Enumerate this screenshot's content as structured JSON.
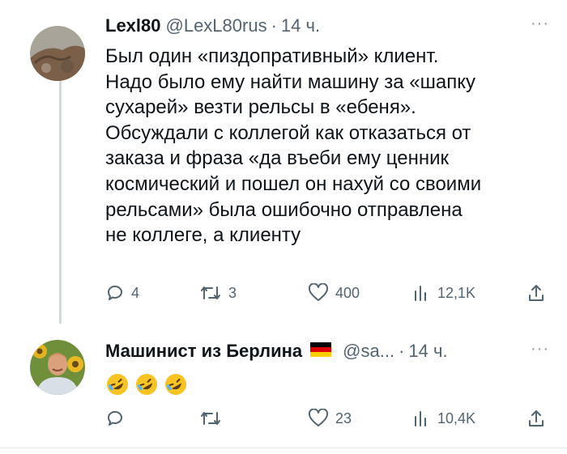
{
  "tweets": [
    {
      "name": "Lexl80",
      "handle": "@LexL80rus",
      "dot": "·",
      "time": "14 ч.",
      "more": "···",
      "text": "Был один «пиздопративный» клиент.\nНадо было ему найти машину за «шапку\nсухарей» везти рельсы в «ебеня».\nОбсуждали с коллегой как отказаться от\nзаказа и фраза «да въеби ему ценник\nкосмический и пошел он нахуй со своими\nрельсами» была ошибочно отправлена\nне коллеге, а клиенту",
      "actions": {
        "replies": "4",
        "retweets": "3",
        "likes": "400",
        "views": "12,1K"
      }
    },
    {
      "name": "Машинист из Берлина",
      "handle": "@sa...",
      "dot": "·",
      "time": "14 ч.",
      "more": "···",
      "flag_icon": "germany-flag-icon",
      "emoji_icon": "rolling-on-the-floor-laughing-emoji",
      "emoji_count": 3,
      "actions": {
        "replies": "",
        "retweets": "",
        "likes": "23",
        "views": "10,4K"
      }
    }
  ],
  "colors": {
    "text": "#0f1419",
    "secondary": "#536471",
    "thread_line": "#cfd9de",
    "flag_black": "#000000",
    "flag_red": "#dd0000",
    "flag_gold": "#ffce00"
  }
}
